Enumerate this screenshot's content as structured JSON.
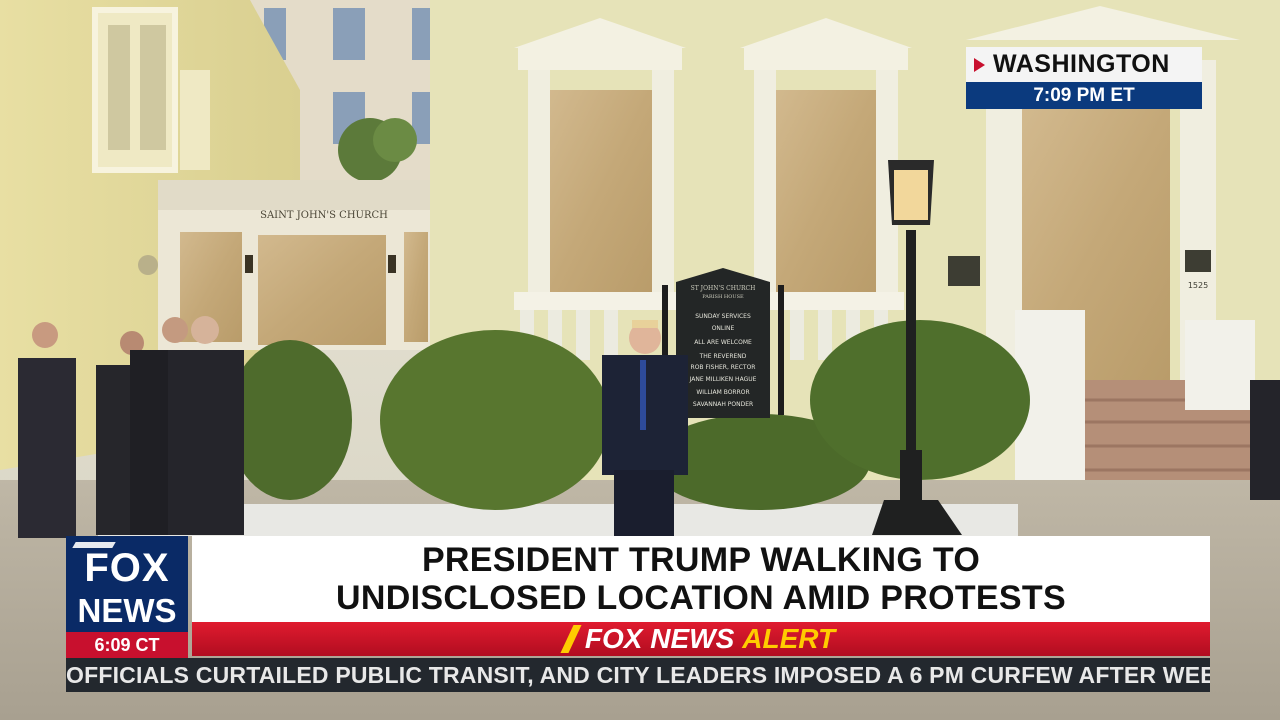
{
  "location": {
    "city": "WASHINGTON",
    "time": "7:09 PM ET"
  },
  "scene": {
    "church_sign": "SAINT JOHN'S CHURCH",
    "parish_board_title": "ST JOHN'S CHURCH",
    "parish_board_subtitle": "PARISH HOUSE",
    "board_lines": [
      "SUNDAY SERVICES",
      "ONLINE",
      "ALL ARE WELCOME",
      "THE REVEREND",
      "ROB FISHER, RECTOR",
      "JANE MILLIKEN HAGUE",
      "WILLIAM BORROR",
      "SAVANNAH PONDER"
    ],
    "house_number": "1525"
  },
  "logo": {
    "fox": "FOX",
    "news": "NEWS",
    "time": "6:09 CT"
  },
  "headline": {
    "line1": "PRESIDENT TRUMP WALKING TO",
    "line2": "UNDISCLOSED LOCATION AMID PROTESTS"
  },
  "alert": {
    "prefix": "FOX NEWS",
    "word": "ALERT"
  },
  "ticker": {
    "text": "OFFICIALS CURTAILED PUBLIC TRANSIT, AND CITY LEADERS IMPOSED A 6 PM CURFEW AFTER WEEKEND PROTESTS"
  },
  "colors": {
    "alert_red": "#c8102e",
    "fox_blue": "#0a2a66",
    "time_blue": "#0b3a7e",
    "alert_yellow": "#ffcc00"
  }
}
